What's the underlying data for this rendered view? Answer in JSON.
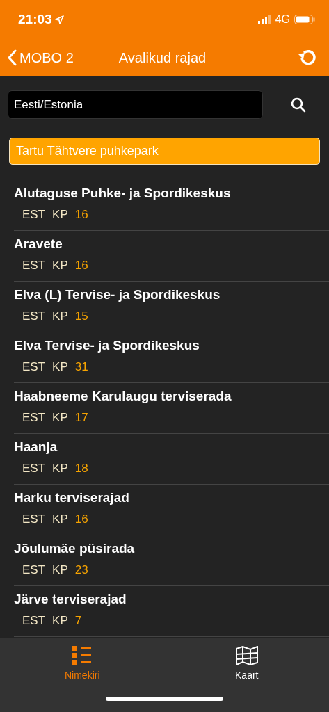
{
  "status_bar": {
    "time": "21:03",
    "network": "4G"
  },
  "nav": {
    "back": "MOBO 2",
    "title": "Avalikud rajad"
  },
  "search": {
    "value": "Eesti/Estonia"
  },
  "highlighted": {
    "name": "Tartu Tähtvere puhkepark"
  },
  "rows": [
    {
      "name": "Alutaguse Puhke- ja Spordikeskus",
      "country": "EST",
      "type": "KP",
      "count": "16"
    },
    {
      "name": "Aravete",
      "country": "EST",
      "type": "KP",
      "count": "16"
    },
    {
      "name": "Elva (L) Tervise- ja Spordikeskus",
      "country": "EST",
      "type": "KP",
      "count": "15"
    },
    {
      "name": "Elva Tervise- ja Spordikeskus",
      "country": "EST",
      "type": "KP",
      "count": "31"
    },
    {
      "name": "Haabneeme Karulaugu terviserada",
      "country": "EST",
      "type": "KP",
      "count": "17"
    },
    {
      "name": "Haanja",
      "country": "EST",
      "type": "KP",
      "count": "18"
    },
    {
      "name": "Harku terviserajad",
      "country": "EST",
      "type": "KP",
      "count": "16"
    },
    {
      "name": "Jõulumäe püsirada",
      "country": "EST",
      "type": "KP",
      "count": "23"
    },
    {
      "name": "Järve terviserajad",
      "country": "EST",
      "type": "KP",
      "count": "7"
    }
  ],
  "tabs": [
    {
      "label": "Nimekiri",
      "kind": "list",
      "selected": true
    },
    {
      "label": "Kaart",
      "kind": "map",
      "selected": false
    }
  ]
}
